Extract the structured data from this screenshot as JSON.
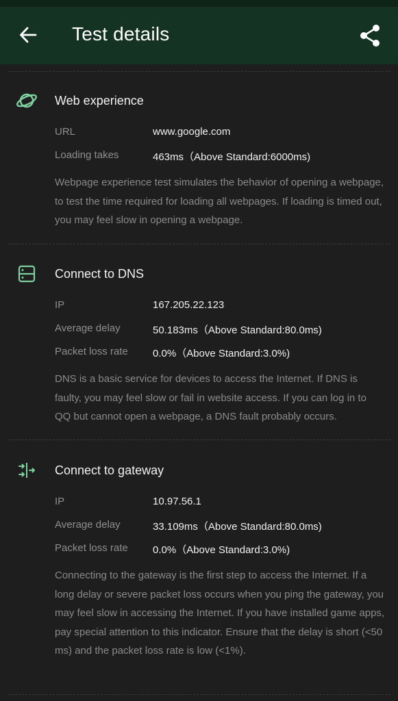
{
  "header": {
    "title": "Test details",
    "back_icon": "arrow-left-icon",
    "share_icon": "share-icon"
  },
  "colors": {
    "background": "#1e1e1e",
    "app_bar": "#143322",
    "accent": "#7fd3a0"
  },
  "sections": [
    {
      "title": "Web experience",
      "icon": "planet-icon",
      "rows": [
        {
          "label": "URL",
          "value": "www.google.com"
        },
        {
          "label": "Loading takes",
          "value": "463ms（Above Standard:6000ms)"
        }
      ],
      "description": "Webpage experience test simulates the behavior of opening a webpage, to test the time required for loading all webpages. If loading is timed out, you may feel slow in opening a webpage."
    },
    {
      "title": "Connect to DNS",
      "icon": "server-icon",
      "rows": [
        {
          "label": "IP",
          "value": "167.205.22.123"
        },
        {
          "label": "Average delay",
          "value": "50.183ms（Above Standard:80.0ms)"
        },
        {
          "label": "Packet loss rate",
          "value": "0.0%（Above Standard:3.0%)"
        }
      ],
      "description": "DNS is a basic service for devices to access the Internet. If DNS is faulty, you may feel slow or fail in website access. If you can log in to QQ but cannot open a webpage, a DNS fault probably occurs."
    },
    {
      "title": "Connect to gateway",
      "icon": "gateway-arrows-icon",
      "rows": [
        {
          "label": "IP",
          "value": "10.97.56.1"
        },
        {
          "label": "Average delay",
          "value": "33.109ms（Above Standard:80.0ms)"
        },
        {
          "label": "Packet loss rate",
          "value": "0.0%（Above Standard:3.0%)"
        }
      ],
      "description": "Connecting to the gateway is the first step to access the Internet. If a long delay or severe packet loss occurs when you ping the gateway, you may feel slow in accessing the Internet. If you have installed game apps, pay special attention to this indicator. Ensure that the delay is short (<50 ms) and the packet loss rate is low (<1%)."
    }
  ]
}
